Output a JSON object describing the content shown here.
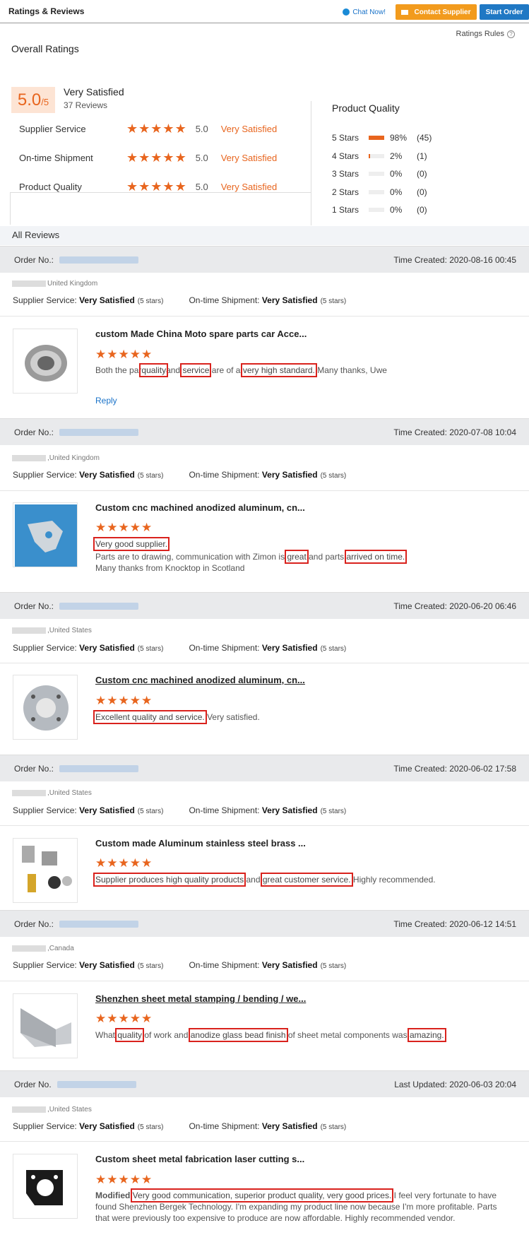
{
  "header": {
    "title": "Ratings & Reviews",
    "chat": "Chat Now!",
    "contact": "Contact Supplier",
    "start": "Start Order"
  },
  "rules": "Ratings Rules",
  "overall": {
    "title": "Overall Ratings",
    "score": "5.0",
    "out_of": "/5",
    "label": "Very Satisfied",
    "count": "37 Reviews",
    "rows": [
      {
        "label": "Supplier Service",
        "value": "5.0",
        "text": "Very Satisfied"
      },
      {
        "label": "On-time Shipment",
        "value": "5.0",
        "text": "Very Satisfied"
      },
      {
        "label": "Product Quality",
        "value": "5.0",
        "text": "Very Satisfied"
      }
    ]
  },
  "product_quality": {
    "title": "Product Quality",
    "dist": [
      {
        "stars": "5 Stars",
        "pct": "98%",
        "count": "(45)",
        "fill": 0.98
      },
      {
        "stars": "4 Stars",
        "pct": "2%",
        "count": "(1)",
        "fill": 0.02
      },
      {
        "stars": "3 Stars",
        "pct": "0%",
        "count": "(0)",
        "fill": 0
      },
      {
        "stars": "2 Stars",
        "pct": "0%",
        "count": "(0)",
        "fill": 0
      },
      {
        "stars": "1 Stars",
        "pct": "0%",
        "count": "(0)",
        "fill": 0
      }
    ]
  },
  "all_reviews": "All Reviews",
  "labels": {
    "order_no": "Order No.:",
    "order_no_alt": "Order No.",
    "supplier_service": "Supplier Service:",
    "on_time": "On-time Shipment:",
    "very_satisfied": "Very Satisfied",
    "five_stars": "(5 stars)",
    "reply": "Reply"
  },
  "reviews": [
    {
      "time": "Time Created: 2020-08-16 00:45",
      "country": "United Kingdom",
      "title": "custom Made China Moto spare parts car Acce...",
      "text": [
        "Both the par",
        "quality",
        "and ",
        "service",
        " are of a ",
        "very high standard.",
        " Many thanks, Uwe"
      ]
    },
    {
      "time": "Time Created: 2020-07-08 10:04",
      "country": ",United Kingdom",
      "title": "Custom cnc machined anodized aluminum, cn...",
      "line1": "Very good supplier.",
      "text": [
        "Parts are to drawing, communication with Zimon is ",
        "great",
        " and parts ",
        "arrived on time.",
        ""
      ],
      "line3": "Many thanks from Knocktop in Scotland"
    },
    {
      "time": "Time Created: 2020-06-20 06:46",
      "country": ",United States",
      "title": "Custom cnc machined anodized aluminum, cn...",
      "text": [
        "",
        "Excellent quality and service.",
        " Very satisfied."
      ]
    },
    {
      "time": "Time Created: 2020-06-02 17:58",
      "country": ",United States",
      "title": "Custom made Aluminum stainless steel brass ...",
      "text": [
        "",
        "Supplier produces high quality products",
        " and ",
        "great customer service.",
        " Highly recommended."
      ]
    },
    {
      "time": "Time Created: 2020-06-12 14:51",
      "country": ",Canada",
      "title": "Shenzhen sheet metal stamping / bending / we...",
      "text": [
        "What ",
        "quality",
        " of work and ",
        "anodize glass bead finish",
        " of sheet metal components was ",
        "amazing.",
        ""
      ]
    },
    {
      "time": "Last Updated: 2020-06-03 20:04",
      "country": ",United States",
      "title": "Custom sheet metal fabrication laser cutting s...",
      "modified": "Modified",
      "hl": "Very good communication, superior product quality, very good prices.",
      "rest1": " I feel very fortunate to have",
      "rest2": "found Shenzhen Bergek Technology. I'm expanding my product line now because I'm more profitable. Parts",
      "rest3": "that were previously too expensive to produce are now affordable. Highly recommended vendor."
    }
  ]
}
